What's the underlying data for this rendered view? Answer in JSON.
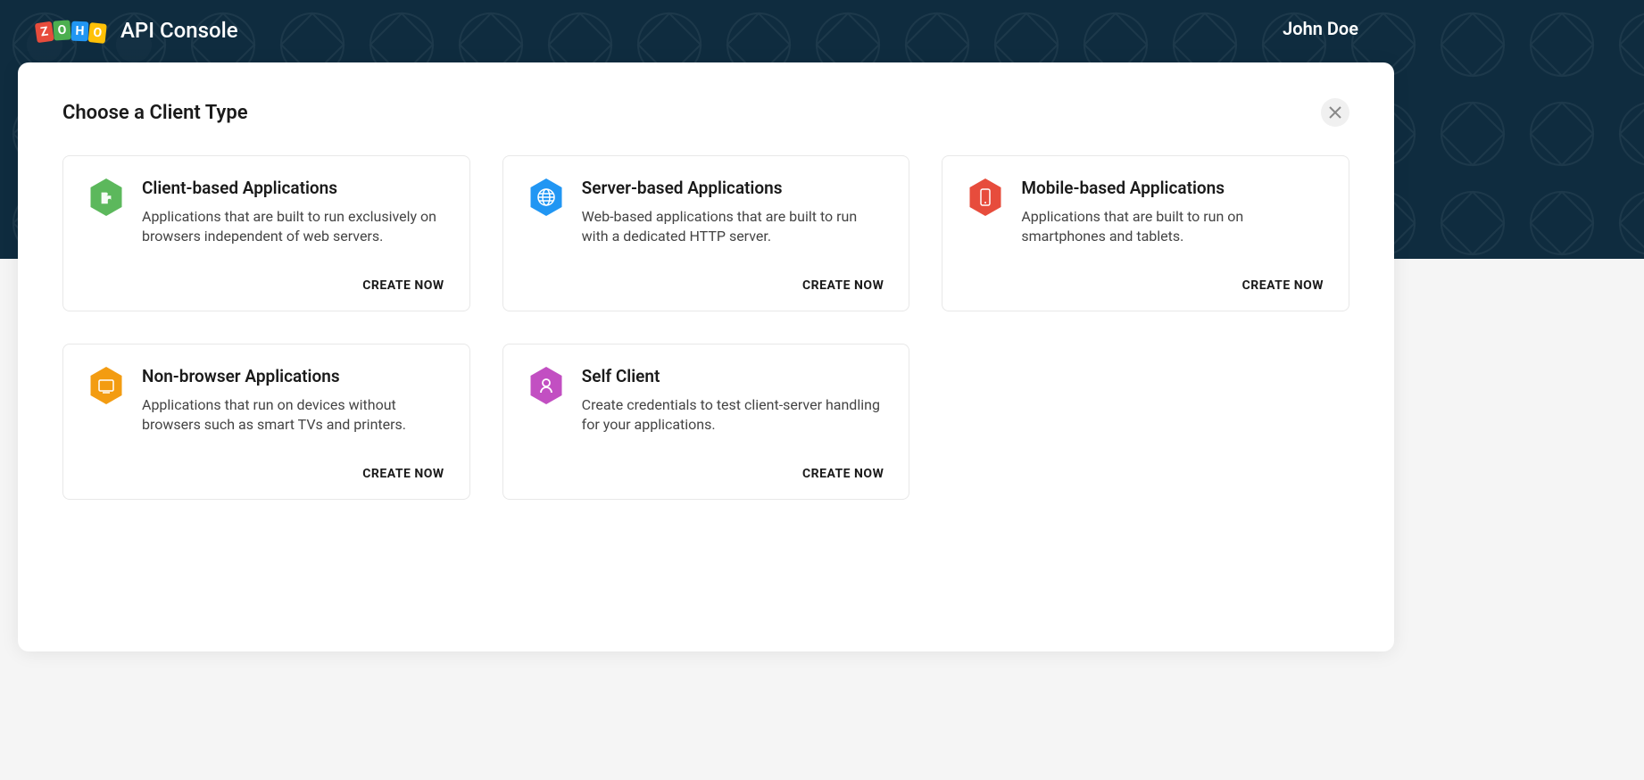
{
  "header": {
    "logo_text": "ZOHO",
    "title": "API Console",
    "user": "John Doe"
  },
  "panel": {
    "title": "Choose a Client Type",
    "close_label": "×"
  },
  "cards": [
    {
      "icon": "puzzle-icon",
      "icon_color": "#5cb85c",
      "title": "Client-based Applications",
      "desc": "Applications that are built to run exclusively on browsers independent of web servers.",
      "action": "CREATE NOW"
    },
    {
      "icon": "globe-icon",
      "icon_color": "#2196f3",
      "title": "Server-based Applications",
      "desc": "Web-based applications that are built to run with a dedicated HTTP server.",
      "action": "CREATE NOW"
    },
    {
      "icon": "mobile-icon",
      "icon_color": "#e74c3c",
      "title": "Mobile-based Applications",
      "desc": "Applications that are built to run on smartphones and tablets.",
      "action": "CREATE NOW"
    },
    {
      "icon": "tv-icon",
      "icon_color": "#f39c12",
      "title": "Non-browser Applications",
      "desc": "Applications that run on devices without browsers such as smart TVs and printers.",
      "action": "CREATE NOW"
    },
    {
      "icon": "person-icon",
      "icon_color": "#c24fc2",
      "title": "Self Client",
      "desc": "Create credentials to test client-server handling for your applications.",
      "action": "CREATE NOW"
    }
  ]
}
